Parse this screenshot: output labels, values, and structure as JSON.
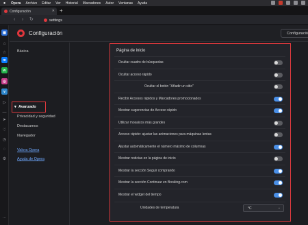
{
  "menubar": {
    "app": "Opera",
    "items": [
      "Archivo",
      "Editar",
      "Ver",
      "Historial",
      "Marcadores",
      "Autor",
      "Ventanas",
      "Ayuda"
    ]
  },
  "tab": {
    "title": "Configuración",
    "close": "✕"
  },
  "newtab": "+",
  "address": {
    "url": "settings"
  },
  "header": {
    "title": "Configuración",
    "search_label": "Configuración"
  },
  "nav": {
    "items": [
      "Básica",
      "Avanzado",
      "Privacidad y seguridad",
      "Destacamos",
      "Navegador"
    ],
    "links": [
      "Valora Opera",
      "Ayuda de Opera"
    ]
  },
  "panel": {
    "title": "Página de inicio",
    "rows": [
      {
        "label": "Ocultar cuadro de búsquedas",
        "on": false
      },
      {
        "label": "Ocultar acceso rápido",
        "on": false
      },
      {
        "label": "Ocultar el botón \"Añadir un sitio\"",
        "on": false,
        "indent": true
      },
      {
        "label": "Recibir Accesos rápidos y Marcadores promocionados",
        "on": true
      },
      {
        "label": "Mostrar sugerencias de Acceso rápido",
        "on": true
      },
      {
        "label": "Utilizar mosaicos más grandes",
        "on": false
      },
      {
        "label": "Acceso rápido: ajustar las animaciones para máquinas lentas",
        "on": false
      },
      {
        "label": "Ajustar automáticamente el número máximo de columnas",
        "on": true
      },
      {
        "label": "Mostrar noticias en la página de inicio",
        "on": false
      },
      {
        "label": "Mostrar la sección Seguir comprando",
        "on": true
      },
      {
        "label": "Mostrar la sección Continuar en Booking.com",
        "on": true
      },
      {
        "label": "Mostrar el widget del tiempo",
        "on": true
      }
    ],
    "units": {
      "label": "Unidades de temperatura",
      "value": "°C"
    }
  },
  "colors": {
    "accent": "#e03a3e",
    "toggle_on": "#4a8fe7",
    "link": "#6ea8ff"
  }
}
